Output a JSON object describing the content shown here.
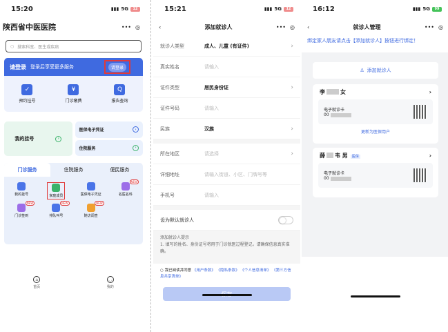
{
  "home": {
    "time": "15:20",
    "signal": "5G",
    "battery": "12",
    "app_title": "陕西省中医医院",
    "more": "•••",
    "search_placeholder": "搜索科室、医生或疾病",
    "login_title": "请登录",
    "login_desc": "登录后享受更多服务",
    "login_button": "请登录",
    "quick": [
      {
        "label": "预约挂号",
        "icon": "calendar-icon",
        "glyph": "✓"
      },
      {
        "label": "门诊缴费",
        "icon": "payment-icon",
        "glyph": "¥"
      },
      {
        "label": "报告查询",
        "icon": "report-search-icon",
        "glyph": "Q"
      }
    ],
    "my_reg": "我的挂号",
    "insurance_voucher": "医保电子凭证",
    "inpatient": "住院服务",
    "tabs": [
      "门诊服务",
      "住院服务",
      "便民服务"
    ],
    "services": [
      {
        "label": "我的挂号",
        "tag": ""
      },
      {
        "label": "家庭成员",
        "tag": ""
      },
      {
        "label": "医保电子凭证",
        "tag": ""
      },
      {
        "label": "名医名科",
        "tag": "NEW"
      },
      {
        "label": "门诊签到",
        "tag": "NEW"
      },
      {
        "label": "排队叫号",
        "tag": "NEW"
      },
      {
        "label": "随访调查",
        "tag": "NEW"
      }
    ],
    "nav": [
      {
        "label": "首页"
      },
      {
        "label": "我的"
      }
    ]
  },
  "add_patient": {
    "time": "15:21",
    "signal": "5G",
    "battery": "12",
    "title": "添加就诊人",
    "more": "•••",
    "fields": [
      {
        "label": "就诊人类型",
        "value": "成人、儿童 (有证件)",
        "placeholder": "",
        "chevron": true
      },
      {
        "label": "真实姓名",
        "value": "",
        "placeholder": "请输入",
        "chevron": false
      },
      {
        "label": "证件类型",
        "value": "居民身份证",
        "placeholder": "",
        "chevron": true
      },
      {
        "label": "证件号码",
        "value": "",
        "placeholder": "请输入",
        "chevron": false
      },
      {
        "label": "民族",
        "value": "汉族",
        "placeholder": "",
        "chevron": true
      }
    ],
    "fields2": [
      {
        "label": "所在地区",
        "value": "",
        "placeholder": "请选择",
        "chevron": true
      },
      {
        "label": "详细地址",
        "value": "",
        "placeholder": "请输入街道、小区、门牌号等",
        "chevron": false
      },
      {
        "label": "手机号",
        "value": "",
        "placeholder": "请输入",
        "chevron": false
      }
    ],
    "default_label": "设为默认就诊人",
    "hint_title": "添加就诊人提示",
    "hint_text": "1. 填写的姓名、身份证号将用于门诊就医过程登记，请确保信息真实准确。",
    "agree_prefix": "我已阅读并同意",
    "agree_links": [
      "《用户条款》",
      "《隐私条款》",
      "《个人信息清单》",
      "《第三方信息共享清单》"
    ],
    "save": "保存"
  },
  "manage": {
    "time": "16:12",
    "signal": "5G",
    "battery": "99",
    "title": "就诊人管理",
    "more": "•••",
    "notice": "绑定家人朋友请点击【添加就诊人】按钮进行绑定！",
    "add_button": "添加就诊人",
    "patients": [
      {
        "name_prefix": "李",
        "gender": "女",
        "badge": "",
        "card_label": "电子就诊卡",
        "card_prefix": "00",
        "action": "更新为医保用户"
      },
      {
        "name_prefix": "薛",
        "name_suffix": "韦",
        "gender": "男",
        "badge": "医保",
        "card_label": "电子就诊卡",
        "card_prefix": "00",
        "action": ""
      }
    ]
  }
}
